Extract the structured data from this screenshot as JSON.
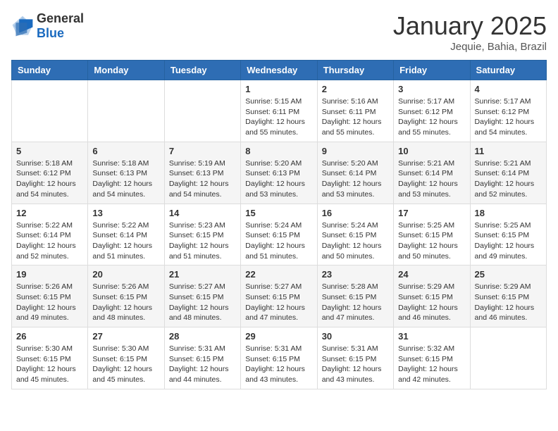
{
  "header": {
    "logo_general": "General",
    "logo_blue": "Blue",
    "month_title": "January 2025",
    "location": "Jequie, Bahia, Brazil"
  },
  "days_of_week": [
    "Sunday",
    "Monday",
    "Tuesday",
    "Wednesday",
    "Thursday",
    "Friday",
    "Saturday"
  ],
  "weeks": [
    [
      {
        "day": "",
        "info": ""
      },
      {
        "day": "",
        "info": ""
      },
      {
        "day": "",
        "info": ""
      },
      {
        "day": "1",
        "info": "Sunrise: 5:15 AM\nSunset: 6:11 PM\nDaylight: 12 hours\nand 55 minutes."
      },
      {
        "day": "2",
        "info": "Sunrise: 5:16 AM\nSunset: 6:11 PM\nDaylight: 12 hours\nand 55 minutes."
      },
      {
        "day": "3",
        "info": "Sunrise: 5:17 AM\nSunset: 6:12 PM\nDaylight: 12 hours\nand 55 minutes."
      },
      {
        "day": "4",
        "info": "Sunrise: 5:17 AM\nSunset: 6:12 PM\nDaylight: 12 hours\nand 54 minutes."
      }
    ],
    [
      {
        "day": "5",
        "info": "Sunrise: 5:18 AM\nSunset: 6:12 PM\nDaylight: 12 hours\nand 54 minutes."
      },
      {
        "day": "6",
        "info": "Sunrise: 5:18 AM\nSunset: 6:13 PM\nDaylight: 12 hours\nand 54 minutes."
      },
      {
        "day": "7",
        "info": "Sunrise: 5:19 AM\nSunset: 6:13 PM\nDaylight: 12 hours\nand 54 minutes."
      },
      {
        "day": "8",
        "info": "Sunrise: 5:20 AM\nSunset: 6:13 PM\nDaylight: 12 hours\nand 53 minutes."
      },
      {
        "day": "9",
        "info": "Sunrise: 5:20 AM\nSunset: 6:14 PM\nDaylight: 12 hours\nand 53 minutes."
      },
      {
        "day": "10",
        "info": "Sunrise: 5:21 AM\nSunset: 6:14 PM\nDaylight: 12 hours\nand 53 minutes."
      },
      {
        "day": "11",
        "info": "Sunrise: 5:21 AM\nSunset: 6:14 PM\nDaylight: 12 hours\nand 52 minutes."
      }
    ],
    [
      {
        "day": "12",
        "info": "Sunrise: 5:22 AM\nSunset: 6:14 PM\nDaylight: 12 hours\nand 52 minutes."
      },
      {
        "day": "13",
        "info": "Sunrise: 5:22 AM\nSunset: 6:14 PM\nDaylight: 12 hours\nand 51 minutes."
      },
      {
        "day": "14",
        "info": "Sunrise: 5:23 AM\nSunset: 6:15 PM\nDaylight: 12 hours\nand 51 minutes."
      },
      {
        "day": "15",
        "info": "Sunrise: 5:24 AM\nSunset: 6:15 PM\nDaylight: 12 hours\nand 51 minutes."
      },
      {
        "day": "16",
        "info": "Sunrise: 5:24 AM\nSunset: 6:15 PM\nDaylight: 12 hours\nand 50 minutes."
      },
      {
        "day": "17",
        "info": "Sunrise: 5:25 AM\nSunset: 6:15 PM\nDaylight: 12 hours\nand 50 minutes."
      },
      {
        "day": "18",
        "info": "Sunrise: 5:25 AM\nSunset: 6:15 PM\nDaylight: 12 hours\nand 49 minutes."
      }
    ],
    [
      {
        "day": "19",
        "info": "Sunrise: 5:26 AM\nSunset: 6:15 PM\nDaylight: 12 hours\nand 49 minutes."
      },
      {
        "day": "20",
        "info": "Sunrise: 5:26 AM\nSunset: 6:15 PM\nDaylight: 12 hours\nand 48 minutes."
      },
      {
        "day": "21",
        "info": "Sunrise: 5:27 AM\nSunset: 6:15 PM\nDaylight: 12 hours\nand 48 minutes."
      },
      {
        "day": "22",
        "info": "Sunrise: 5:27 AM\nSunset: 6:15 PM\nDaylight: 12 hours\nand 47 minutes."
      },
      {
        "day": "23",
        "info": "Sunrise: 5:28 AM\nSunset: 6:15 PM\nDaylight: 12 hours\nand 47 minutes."
      },
      {
        "day": "24",
        "info": "Sunrise: 5:29 AM\nSunset: 6:15 PM\nDaylight: 12 hours\nand 46 minutes."
      },
      {
        "day": "25",
        "info": "Sunrise: 5:29 AM\nSunset: 6:15 PM\nDaylight: 12 hours\nand 46 minutes."
      }
    ],
    [
      {
        "day": "26",
        "info": "Sunrise: 5:30 AM\nSunset: 6:15 PM\nDaylight: 12 hours\nand 45 minutes."
      },
      {
        "day": "27",
        "info": "Sunrise: 5:30 AM\nSunset: 6:15 PM\nDaylight: 12 hours\nand 45 minutes."
      },
      {
        "day": "28",
        "info": "Sunrise: 5:31 AM\nSunset: 6:15 PM\nDaylight: 12 hours\nand 44 minutes."
      },
      {
        "day": "29",
        "info": "Sunrise: 5:31 AM\nSunset: 6:15 PM\nDaylight: 12 hours\nand 43 minutes."
      },
      {
        "day": "30",
        "info": "Sunrise: 5:31 AM\nSunset: 6:15 PM\nDaylight: 12 hours\nand 43 minutes."
      },
      {
        "day": "31",
        "info": "Sunrise: 5:32 AM\nSunset: 6:15 PM\nDaylight: 12 hours\nand 42 minutes."
      },
      {
        "day": "",
        "info": ""
      }
    ]
  ]
}
